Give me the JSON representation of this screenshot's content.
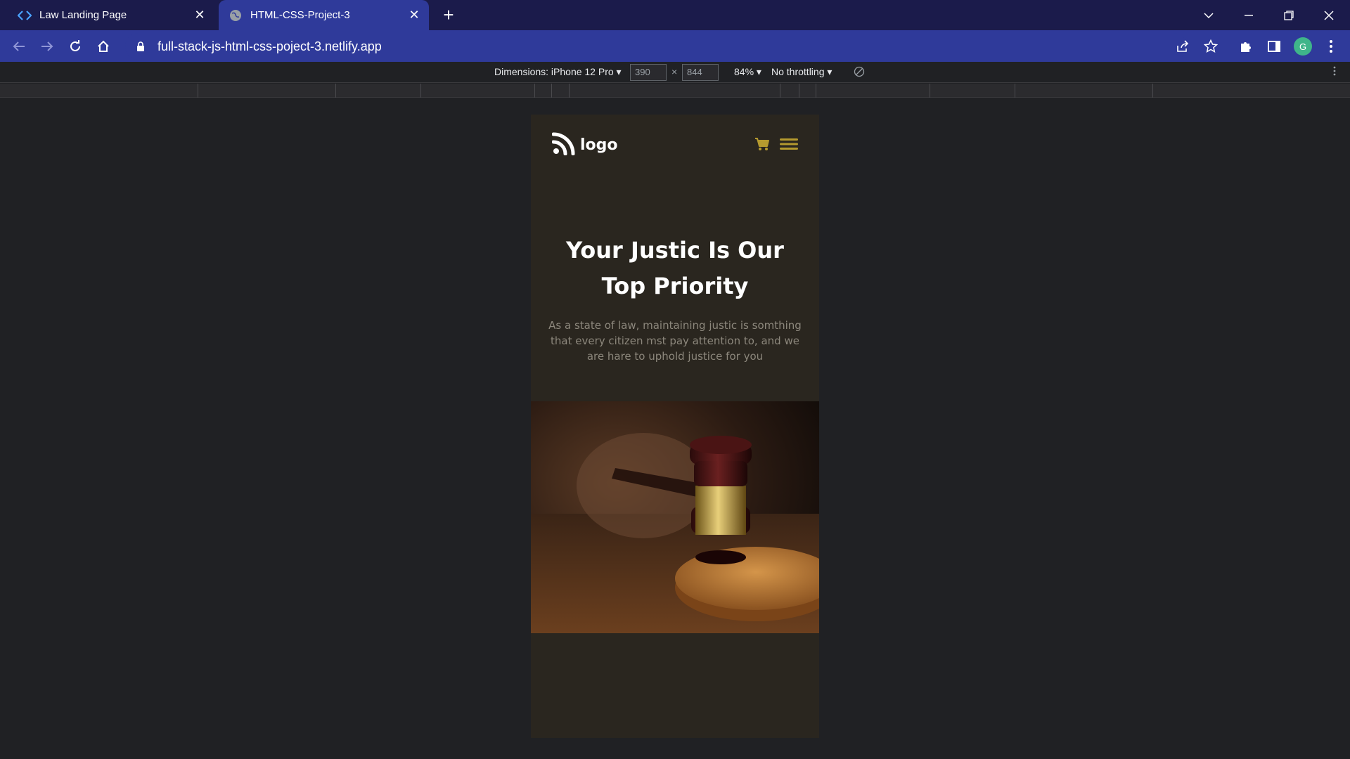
{
  "browser": {
    "tabs": [
      {
        "title": "Law Landing Page",
        "active": false,
        "icon": "code-icon"
      },
      {
        "title": "HTML-CSS-Project-3",
        "active": true,
        "icon": "globe-icon"
      }
    ],
    "url": "full-stack-js-html-css-poject-3.netlify.app",
    "profile_initial": "G"
  },
  "devtools": {
    "dimensions_label": "Dimensions: iPhone 12 Pro",
    "width": "390",
    "height": "844",
    "times": "×",
    "zoom": "84%",
    "throttling": "No throttling"
  },
  "site": {
    "logo_text": "logo",
    "hero_title": "Your Justic Is Our Top Priority",
    "hero_text": "As a state of law, maintaining justic is somthing that every citizen mst pay attention to, and we are hare to uphold justice for you",
    "accent_color": "#b59a2f",
    "background_color": "#2a261f"
  }
}
